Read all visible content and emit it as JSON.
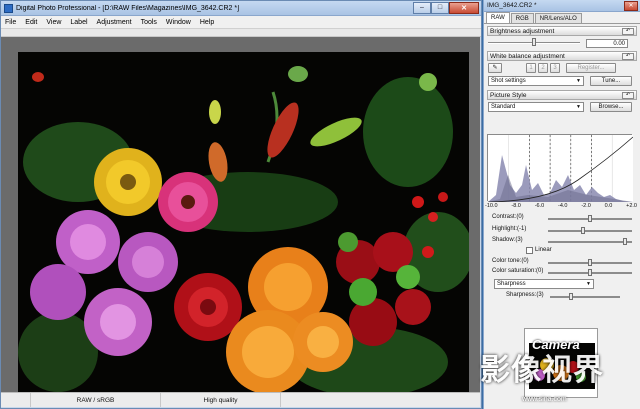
{
  "main_window": {
    "title": "Digital Photo Professional - [D:\\RAW Files\\Magazines\\IMG_3642.CR2 *]",
    "controls": {
      "minimize": "–",
      "maximize": "□",
      "close": "✕"
    },
    "menu": [
      "File",
      "Edit",
      "View",
      "Label",
      "Adjustment",
      "Tools",
      "Window",
      "Help"
    ],
    "status": {
      "color_space": "RAW / sRGB",
      "quality": "High quality"
    }
  },
  "palette": {
    "title": "IMG_3642.CR2 *",
    "close": "✕",
    "tabs": [
      {
        "label": "RAW",
        "active": true
      },
      {
        "label": "RGB",
        "active": false
      },
      {
        "label": "NR/Lens/ALO",
        "active": false
      }
    ],
    "brightness": {
      "heading": "Brightness adjustment",
      "value": "0.00",
      "level": 0.5
    },
    "white_balance": {
      "heading": "White balance adjustment",
      "presets": [
        "1",
        "2",
        "3"
      ],
      "register_label": "Register...",
      "selected": "Shot settings",
      "tune_label": "Tune..."
    },
    "picture_style": {
      "heading": "Picture Style",
      "selected": "Standard",
      "browse_label": "Browse...",
      "histogram_axis": [
        "-10.0",
        "-8.0",
        "-6.0",
        "-4.0",
        "-2.0",
        "0.0",
        "+2.0"
      ],
      "params": [
        {
          "label": "Contrast:(0)",
          "level": 0.5
        },
        {
          "label": "Highlight:(-1)",
          "level": 0.42
        },
        {
          "label": "Shadow:(3)",
          "level": 0.92
        },
        {
          "label": "Color tone:(0)",
          "level": 0.5
        },
        {
          "label": "Color saturation:(0)",
          "level": 0.5
        }
      ],
      "linear_label": "Linear",
      "sharpness_mode": "Sharpness",
      "sharpness_label": "Sharpness:(3)",
      "sharpness_level": 0.3
    },
    "thumbnail_icon": "flower-photo-thumbnail"
  },
  "watermark": {
    "brand": "Camera",
    "cjk": "影像视界",
    "site": "www.sina.com"
  },
  "colors": {
    "title_gradient": "#a9c3e4",
    "viewer_bg": "#6b6b6b",
    "palette_bg": "#f0f0f0",
    "close_red": "#c84a33"
  }
}
